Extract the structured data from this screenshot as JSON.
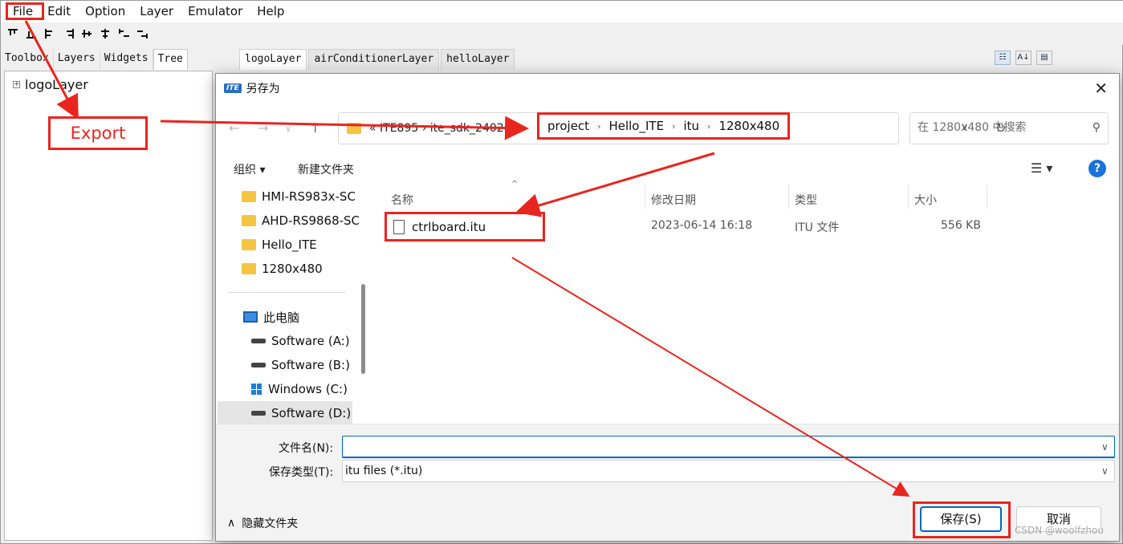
{
  "menu": [
    "File",
    "Edit",
    "Option",
    "Layer",
    "Emulator",
    "Help"
  ],
  "left_tabs": [
    "Toolbox",
    "Layers",
    "Widgets",
    "Tree"
  ],
  "tree": {
    "node": "logoLayer"
  },
  "doc_tabs": [
    "logoLayer",
    "airConditionerLayer",
    "helloLayer"
  ],
  "dialog": {
    "title": "另存为",
    "address": {
      "hidden_crumbs": "« ITE895 › ite_sdk_2402 ›",
      "crumbs": [
        "project",
        "Hello_ITE",
        "itu",
        "1280x480"
      ]
    },
    "search_placeholder": "在 1280x480 中搜索",
    "commands": {
      "organize": "组织 ▾",
      "new_folder": "新建文件夹"
    },
    "nav": {
      "folders": [
        "HMI-RS983x-SC",
        "AHD-RS9868-SC",
        "Hello_ITE",
        "1280x480"
      ],
      "this_pc": "此电脑",
      "drives": [
        "Software (A:)",
        "Software (B:)",
        "Windows (C:)",
        "Software (D:)"
      ]
    },
    "columns": [
      "名称",
      "修改日期",
      "类型",
      "大小"
    ],
    "files": [
      {
        "name": "ctrlboard.itu",
        "modified": "2023-06-14 16:18",
        "type": "ITU 文件",
        "size": "556 KB"
      }
    ],
    "filename_label": "文件名(N):",
    "filename_value": "",
    "filetype_label": "保存类型(T):",
    "filetype_value": "itu files (*.itu)",
    "hide_folders": "隐藏文件夹",
    "save": "保存(S)",
    "cancel": "取消"
  },
  "annotation": {
    "export": "Export",
    "color": "#e8251f"
  },
  "watermark": "CSDN @woolfzhou"
}
